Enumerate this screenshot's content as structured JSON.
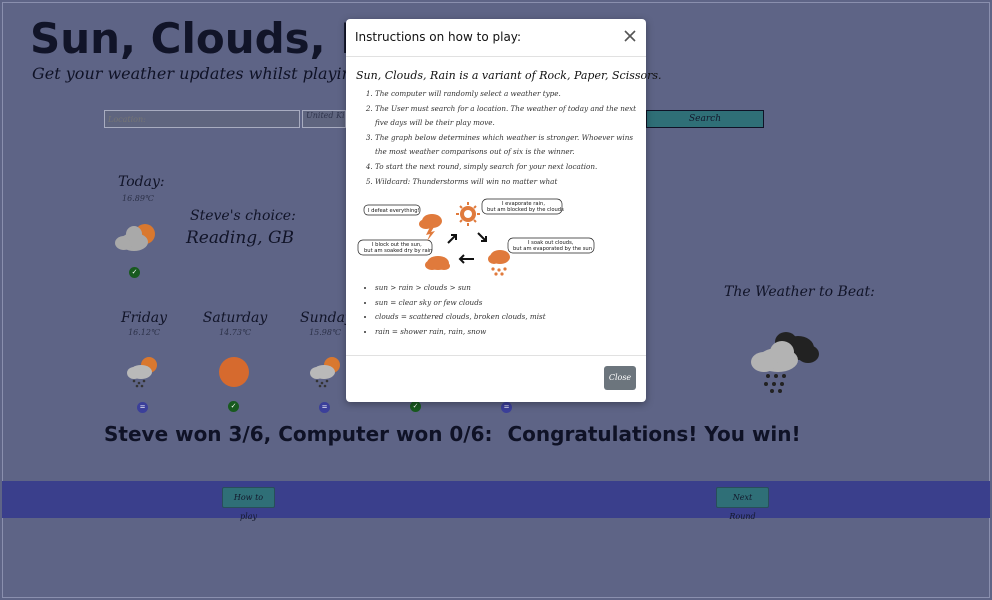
{
  "app": {
    "title": "Sun, Clouds, Rain",
    "subtitle": "Get your weather updates whilst playing a game!"
  },
  "search": {
    "location_placeholder": "Location:",
    "country_value": "United Kingdom",
    "button_label": "Search"
  },
  "today": {
    "label": "Today:",
    "temp": "16.89℃",
    "icon": "cloud-sun-icon",
    "result": "win"
  },
  "player": {
    "choice_label": "Steve's choice:",
    "location": "Reading, GB"
  },
  "forecast": [
    {
      "day": "Friday",
      "temp": "16.12℃",
      "icon": "cloud-sun-rain-icon",
      "result": "draw"
    },
    {
      "day": "Saturday",
      "temp": "14.73℃",
      "icon": "sun-icon",
      "result": "win"
    },
    {
      "day": "Sunday",
      "temp": "15.98℃",
      "icon": "cloud-sun-rain-icon",
      "result": "draw"
    },
    {
      "day": "",
      "temp": "",
      "icon": "",
      "result": "win"
    },
    {
      "day": "",
      "temp": "",
      "icon": "",
      "result": "draw"
    }
  ],
  "score": {
    "text": "Steve won 3/6, Computer won 0/6:",
    "verdict": "Congratulations! You win!"
  },
  "opponent": {
    "label": "The Weather to Beat:",
    "icon": "cloud-rain-dark-icon"
  },
  "footer": {
    "how_to_play": "How to play",
    "next_round": "Next Round"
  },
  "modal": {
    "title": "Instructions on how to play:",
    "intro": "Sun, Clouds, Rain is a variant of Rock, Paper, Scissors.",
    "rules": [
      "The computer will randomly select a weather type.",
      "The User must search for a location. The weather of today and the next five days will be their play move.",
      "The graph below determines which weather is stronger. Whoever wins the most weather comparisons out of six is the winner.",
      "To start the next round, simply search for your next location.",
      "Wildcard: Thunderstorms will win no matter what"
    ],
    "diagram": {
      "bubble_thunder": "I defeat everything!",
      "bubble_sun_1": "I evaporate rain,",
      "bubble_sun_2": "but am blocked by the clouds",
      "bubble_cloud_1": "I block out the sun,",
      "bubble_cloud_2": "but am soaked dry by rain",
      "bubble_rain_1": "I soak out clouds,",
      "bubble_rain_2": "but am evaporated by the sun"
    },
    "bullets": [
      "sun > rain > clouds > sun",
      "sun = clear sky or few clouds",
      "clouds = scattered clouds, broken clouds, mist",
      "rain = shower rain, rain, snow"
    ],
    "close_label": "Close"
  },
  "colors": {
    "background": "#5e6486",
    "footer": "#3a3f8c",
    "button": "#2f6f77",
    "weather_orange": "#e07a3c",
    "win_badge": "#185a1f",
    "draw_badge": "#3b3f9a"
  }
}
